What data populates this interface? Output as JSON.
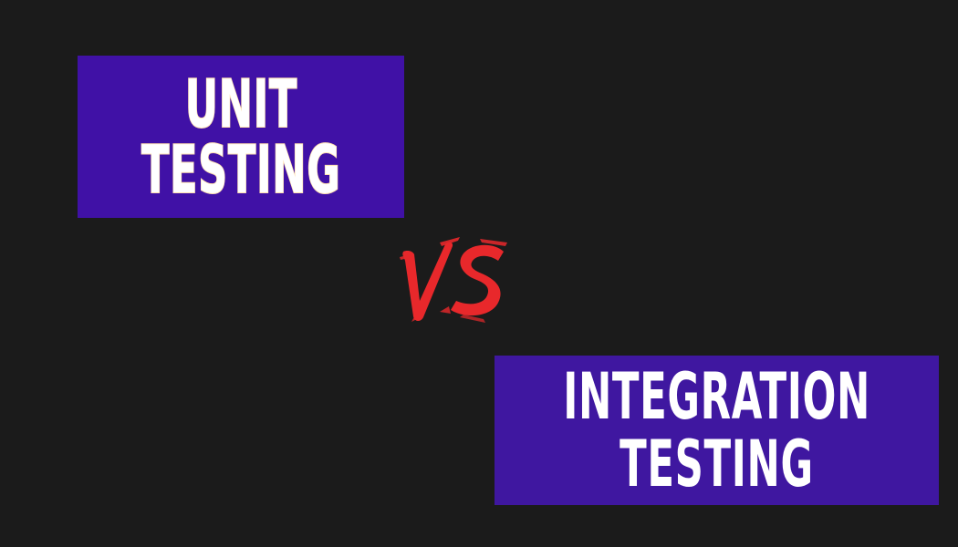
{
  "left_box": {
    "line1": "UNIT",
    "line2": "TESTING",
    "background": "#4011a6"
  },
  "right_box": {
    "line1": "INTEGRATION",
    "line2": "TESTING",
    "background": "#3f17a0"
  },
  "versus": {
    "label": "VS",
    "color": "#e8282b"
  },
  "page_background": "#1b1b1b"
}
